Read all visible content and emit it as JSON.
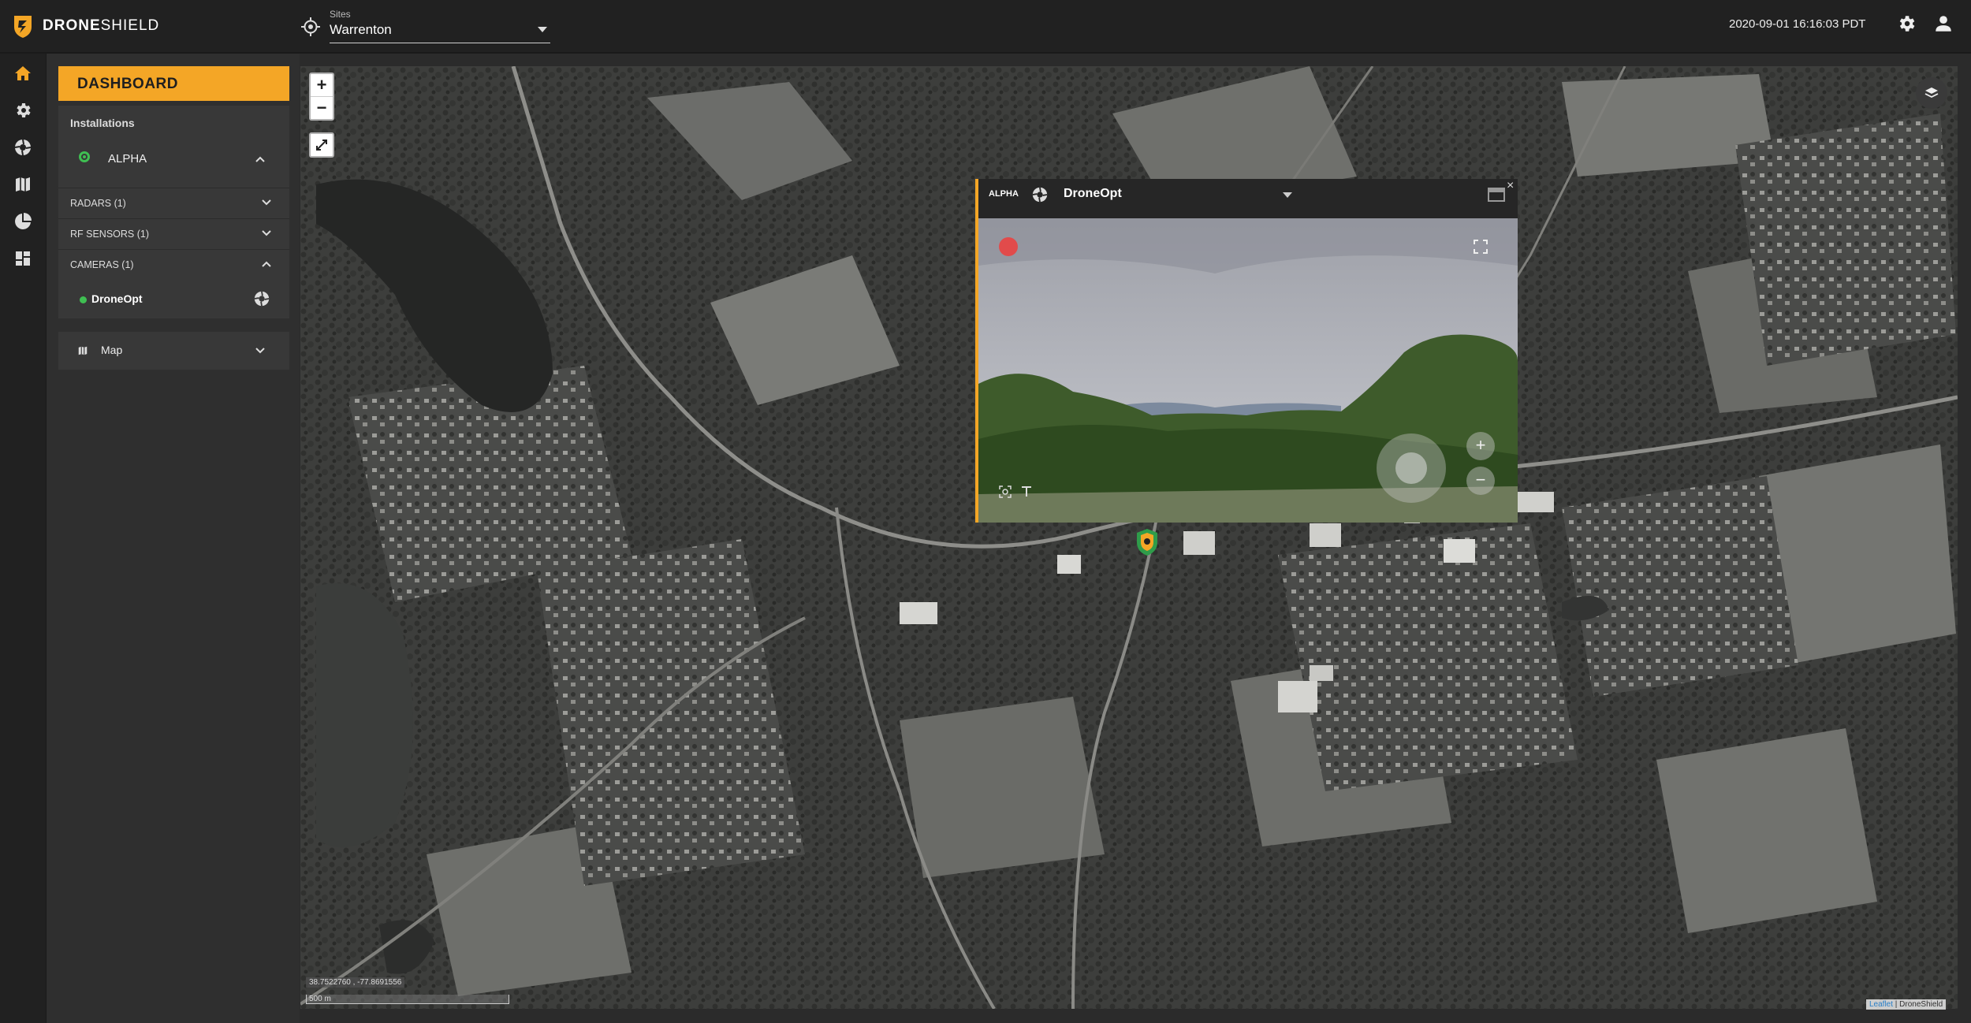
{
  "brand": {
    "name_bold": "DRONE",
    "name_thin": "SHIELD"
  },
  "header": {
    "sites_label": "Sites",
    "site_value": "Warrenton",
    "datetime": "2020-09-01 16:16:03 PDT"
  },
  "rail": {
    "icons": [
      "home-icon",
      "gear-icon",
      "aperture-icon",
      "map-icon",
      "pie-chart-icon",
      "dashboard-grid-icon"
    ]
  },
  "panel": {
    "dashboard_label": "DASHBOARD",
    "installations_label": "Installations",
    "installation": {
      "name": "ALPHA",
      "status_color": "#3fbf52"
    },
    "sections": [
      {
        "label": "RADARS (1)",
        "expanded": false
      },
      {
        "label": "RF SENSORS (1)",
        "expanded": false
      },
      {
        "label": "CAMERAS (1)",
        "expanded": true
      }
    ],
    "camera_item": {
      "name": "DroneOpt",
      "status_color": "#3fbf52"
    },
    "map_section": {
      "label": "Map"
    }
  },
  "map": {
    "zoom_in": "+",
    "zoom_out": "−",
    "coords": "38.7522760 , -77.8691556",
    "scale": "500 m",
    "attribution_link": "Leaflet",
    "attribution_text": " | DroneShield"
  },
  "camera_window": {
    "installation": "ALPHA",
    "camera_name": "DroneOpt",
    "close": "×",
    "zoom_plus": "+",
    "zoom_minus": "−"
  },
  "colors": {
    "accent": "#f4a626",
    "online": "#3fbf52",
    "record": "#e14b4b"
  }
}
